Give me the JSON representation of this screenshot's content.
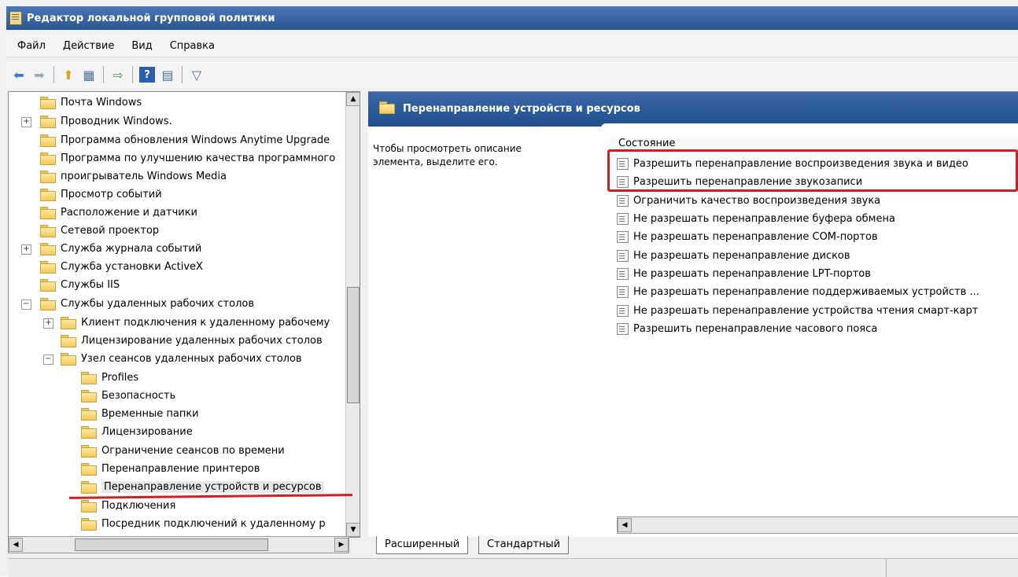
{
  "window": {
    "title": "Редактор локальной групповой политики"
  },
  "menu": [
    "Файл",
    "Действие",
    "Вид",
    "Справка"
  ],
  "toolbar_icons": [
    "back-icon",
    "forward-icon",
    "up-folder-icon",
    "show-tree-icon",
    "export-icon",
    "help-icon",
    "properties-icon",
    "filter-icon"
  ],
  "tree": {
    "items": [
      {
        "label": "Почта Windows"
      },
      {
        "label": "Проводник Windows."
      },
      {
        "label": "Программа обновления Windows Anytime Upgrade"
      },
      {
        "label": "Программа по улучшению качества программного"
      },
      {
        "label": "проигрыватель Windows Media"
      },
      {
        "label": "Просмотр событий"
      },
      {
        "label": "Расположение и датчики"
      },
      {
        "label": "Сетевой проектор"
      },
      {
        "label": "Служба журнала событий"
      },
      {
        "label": "Служба установки ActiveX"
      },
      {
        "label": "Службы IIS"
      },
      {
        "label": "Службы удаленных рабочих столов"
      },
      {
        "label": "Клиент подключения к удаленному рабочему"
      },
      {
        "label": "Лицензирование удаленных рабочих столов"
      },
      {
        "label": "Узел сеансов удаленных рабочих столов"
      },
      {
        "label": "Profiles"
      },
      {
        "label": "Безопасность"
      },
      {
        "label": "Временные папки"
      },
      {
        "label": "Лицензирование"
      },
      {
        "label": "Ограничение сеансов по времени"
      },
      {
        "label": "Перенаправление принтеров"
      },
      {
        "label": "Перенаправление устройств и ресурсов"
      },
      {
        "label": "Подключения"
      },
      {
        "label": "Посредник подключений к удаленному р"
      }
    ]
  },
  "right": {
    "header": "Перенаправление устройств и ресурсов",
    "description": "Чтобы просмотреть описание элемента, выделите его.",
    "column_header": "Состояние",
    "rows": [
      {
        "label": "Разрешить перенаправление воспроизведения звука и видео"
      },
      {
        "label": "Разрешить перенаправление звукозаписи"
      },
      {
        "label": "Ограничить качество воспроизведения звука"
      },
      {
        "label": "Не разрешать перенаправление буфера обмена"
      },
      {
        "label": "Не разрешать перенаправление COM-портов"
      },
      {
        "label": "Не разрешать перенаправление дисков"
      },
      {
        "label": "Не разрешать перенаправление LPT-портов"
      },
      {
        "label": "Не разрешать перенаправление поддерживаемых устройств ..."
      },
      {
        "label": "Не разрешать перенаправление устройства чтения смарт-карт"
      },
      {
        "label": "Разрешить перенаправление часового пояса"
      }
    ]
  },
  "tabs": [
    "Расширенный",
    "Стандартный"
  ],
  "colors": {
    "highlight": "#d21f24",
    "header_blue": "#2a5590"
  }
}
